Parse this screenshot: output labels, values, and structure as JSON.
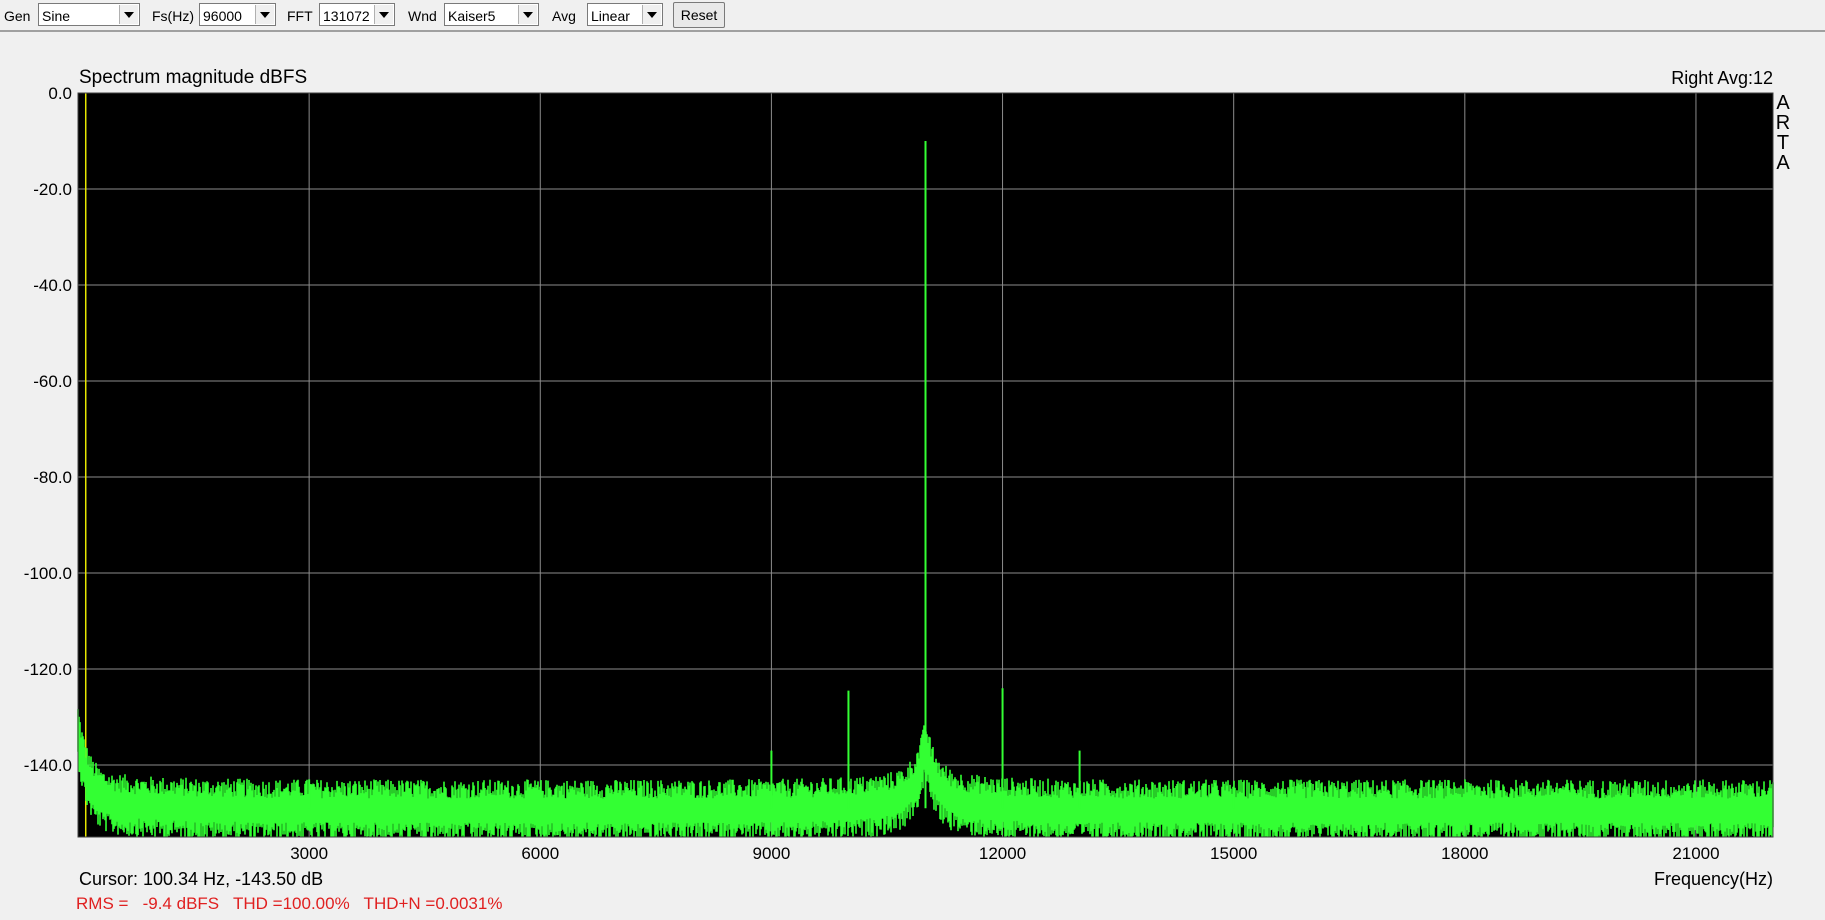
{
  "toolbar": {
    "gen_label": "Gen",
    "gen_value": "Sine",
    "fs_label": "Fs(Hz)",
    "fs_value": "96000",
    "fft_label": "FFT",
    "fft_value": "131072",
    "wnd_label": "Wnd",
    "wnd_value": "Kaiser5",
    "avg_label": "Avg",
    "avg_value": "Linear",
    "reset_label": "Reset"
  },
  "chart_header": {
    "title": "Spectrum magnitude dBFS",
    "channel_avg": "Right  Avg:12",
    "logo_letters": [
      "A",
      "R",
      "T",
      "A"
    ]
  },
  "footer": {
    "cursor": "Cursor: 100.34 Hz, -143.50 dB",
    "x_axis_label": "Frequency(Hz)",
    "measurements": "RMS =   -9.4 dBFS   THD =100.00%   THD+N =0.0031%"
  },
  "colors": {
    "plot_background": "#000000",
    "trace": "#33ff33",
    "grid": "#8c8c8c",
    "cursor_line": "#e6e600",
    "measurement_text": "#e02020"
  },
  "chart_data": {
    "type": "line",
    "title": "Spectrum magnitude dBFS",
    "xlabel": "Frequency(Hz)",
    "ylabel": "",
    "xlim": [
      0,
      22000
    ],
    "ylim": [
      -155,
      0
    ],
    "x_ticks": [
      3000,
      6000,
      9000,
      12000,
      15000,
      18000,
      21000
    ],
    "x_tick_labels": [
      "3000",
      "6000",
      "9000",
      "12000",
      "15000",
      "18000",
      "21000"
    ],
    "y_ticks": [
      0,
      -20,
      -40,
      -60,
      -80,
      -100,
      -120,
      -140
    ],
    "y_tick_labels": [
      "0.0",
      "-20.0",
      "-40.0",
      "-60.0",
      "-80.0",
      "-100.0",
      "-120.0",
      "-140.0"
    ],
    "grid": true,
    "noise_floor_db": -149,
    "cursor_x_hz": 100.34,
    "series": [
      {
        "x": [
          0,
          150,
          500,
          1000,
          3000,
          8900,
          9000,
          9100,
          10000,
          10600,
          10900,
          11000,
          11100,
          11400,
          12000,
          13000,
          15000,
          22000
        ],
        "y": [
          -134,
          -142,
          -146,
          -148,
          -149,
          -149,
          -147,
          -149,
          -148,
          -147,
          -142,
          -10,
          -142,
          -147,
          -148,
          -149,
          -149,
          -149
        ]
      }
    ],
    "peaks": [
      {
        "x": 9000,
        "y": -137
      },
      {
        "x": 10000,
        "y": -124.5
      },
      {
        "x": 11000,
        "y": -10
      },
      {
        "x": 12000,
        "y": -124
      },
      {
        "x": 13000,
        "y": -137
      },
      {
        "x": 3000,
        "y": -143
      },
      {
        "x": 15000,
        "y": -146
      }
    ]
  }
}
